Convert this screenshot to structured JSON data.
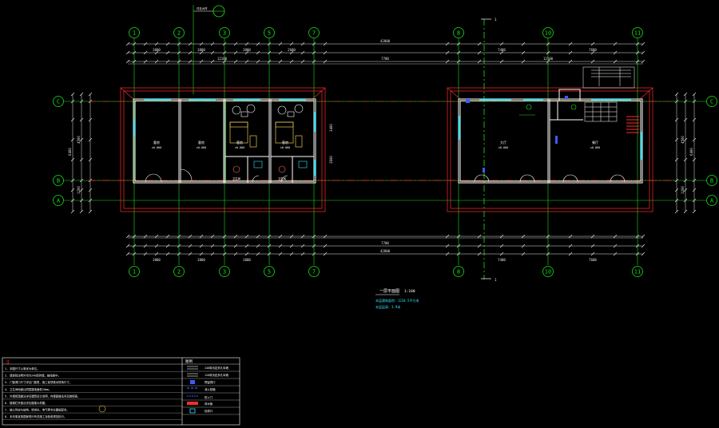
{
  "axes_top": [
    "1",
    "2",
    "3",
    "5",
    "7",
    "8",
    "10",
    "11"
  ],
  "axes_side": [
    "C",
    "B",
    "A"
  ],
  "dims": {
    "overall": "42800",
    "seg_left": "12100",
    "seg_mid": "7700",
    "seg_right": "12100",
    "bays": [
      "3800",
      "3800",
      "3800",
      "2600",
      "2600",
      "7400",
      "7600"
    ],
    "side": [
      "1200",
      "4500",
      "6400"
    ],
    "depth": "3400"
  },
  "rooms": {
    "r1_name": "客房",
    "r1_level": "±0.000",
    "r2_name": "客房",
    "r2_level": "±0.000",
    "r3_name": "客房",
    "r3_level": "±0.000",
    "r4_name": "客房",
    "r4_level": "±0.000",
    "wc": "卫生间",
    "hall": "大厅",
    "hall_level": "±0.000",
    "dining": "餐厅",
    "dining_level": "±0.000"
  },
  "section_mark": "1",
  "index_mark": "详见大样",
  "plan_title": "一层平面图",
  "plan_scale": "1:100",
  "plan_note1": "本层建筑面积：1234.5平方米",
  "plan_note2": "本层层高：3.9米",
  "notes": {
    "heading": "注",
    "lines": [
      "1. 本图尺寸以毫米为单位。",
      "2. 墙体除注明外均为240厚砖墙，轴线居中。",
      "3. 门窗洞口尺寸详见门窗表，施工前须核对现场尺寸。",
      "4. 卫生间地面比同层楼地面低20mm。",
      "5. 外墙保温做法详见建筑设计说明，内墙面做法详见装修表。",
      "6. 楼梯栏杆做法详见楼梯大样图。",
      "7. 施工时应与结构、给排水、电气等专业图纸配合。",
      "8. 未尽事宜按国家现行有关施工及验收规范执行。"
    ]
  },
  "legend": {
    "heading": "图例",
    "items": [
      "240厚页岩多孔砖墙",
      "120厚页岩多孔砖墙",
      "预留洞口",
      "消火栓箱",
      "防火门",
      "排水管",
      "检修口"
    ]
  },
  "colors": {
    "axis": "#19e019",
    "wall": "#ffffff",
    "glass": "#33e6ff",
    "redline": "#ff2b2b",
    "dim": "#e8e8e8",
    "blue": "#3a5cff",
    "furniture": "#e6c84a"
  }
}
